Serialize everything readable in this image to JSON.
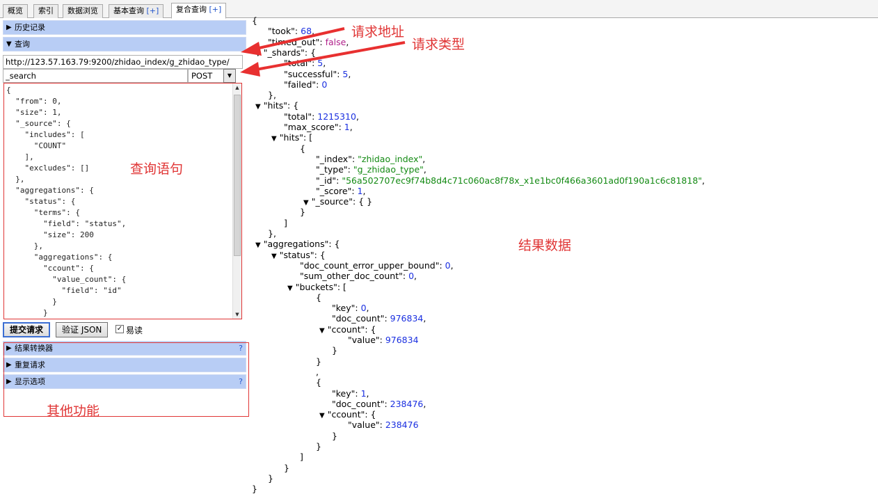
{
  "tabs": [
    {
      "label": "概览",
      "plus": ""
    },
    {
      "label": "索引",
      "plus": ""
    },
    {
      "label": "数据浏览",
      "plus": ""
    },
    {
      "label": "基本查询",
      "plus": "[+]"
    },
    {
      "label": "复合查询",
      "plus": "[+]"
    }
  ],
  "left": {
    "history_label": "历史记录",
    "query_label": "查询",
    "url_value": "http://123.57.163.79:9200/zhidao_index/g_zhidao_type/",
    "path_value": "_search",
    "method_value": "POST",
    "editor_text": "{\n  \"from\": 0,\n  \"size\": 1,\n  \"_source\": {\n    \"includes\": [\n      \"COUNT\"\n    ],\n    \"excludes\": []\n  },\n  \"aggregations\": {\n    \"status\": {\n      \"terms\": {\n        \"field\": \"status\",\n        \"size\": 200\n      },\n      \"aggregations\": {\n        \"ccount\": {\n          \"value_count\": {\n            \"field\": \"id\"\n          }\n        }",
    "submit_label": "提交请求",
    "validate_label": "验证 JSON",
    "easy_label": "易读",
    "easy_checked": "✓",
    "sections": [
      {
        "label": "结果转换器",
        "help": "?"
      },
      {
        "label": "重复请求",
        "help": ""
      },
      {
        "label": "显示选项",
        "help": "?"
      }
    ]
  },
  "annotations": {
    "request_address": "请求地址",
    "request_type": "请求类型",
    "query_statement": "查询语句",
    "result_data": "结果数据",
    "other_functions": "其他功能"
  },
  "result_lines": [
    {
      "i": 0,
      "t": false,
      "parts": [
        {
          "c": "k",
          "v": "{"
        }
      ]
    },
    {
      "i": 1,
      "t": false,
      "parts": [
        {
          "c": "k",
          "v": "\"took\": "
        },
        {
          "c": "num",
          "v": "68"
        },
        {
          "c": "k",
          "v": ","
        }
      ]
    },
    {
      "i": 1,
      "t": false,
      "parts": [
        {
          "c": "k",
          "v": "\"timed_out\": "
        },
        {
          "c": "bool",
          "v": "false"
        },
        {
          "c": "k",
          "v": ","
        }
      ]
    },
    {
      "i": 1,
      "t": true,
      "parts": [
        {
          "c": "k",
          "v": "\"_shards\": {"
        }
      ]
    },
    {
      "i": 2,
      "t": false,
      "parts": [
        {
          "c": "k",
          "v": "\"total\": "
        },
        {
          "c": "num",
          "v": "5"
        },
        {
          "c": "k",
          "v": ","
        }
      ]
    },
    {
      "i": 2,
      "t": false,
      "parts": [
        {
          "c": "k",
          "v": "\"successful\": "
        },
        {
          "c": "num",
          "v": "5"
        },
        {
          "c": "k",
          "v": ","
        }
      ]
    },
    {
      "i": 2,
      "t": false,
      "parts": [
        {
          "c": "k",
          "v": "\"failed\": "
        },
        {
          "c": "num",
          "v": "0"
        }
      ]
    },
    {
      "i": 1,
      "t": false,
      "parts": [
        {
          "c": "k",
          "v": "},"
        }
      ]
    },
    {
      "i": 1,
      "t": true,
      "parts": [
        {
          "c": "k",
          "v": "\"hits\": {"
        }
      ]
    },
    {
      "i": 2,
      "t": false,
      "parts": [
        {
          "c": "k",
          "v": "\"total\": "
        },
        {
          "c": "num",
          "v": "1215310"
        },
        {
          "c": "k",
          "v": ","
        }
      ]
    },
    {
      "i": 2,
      "t": false,
      "parts": [
        {
          "c": "k",
          "v": "\"max_score\": "
        },
        {
          "c": "num",
          "v": "1"
        },
        {
          "c": "k",
          "v": ","
        }
      ]
    },
    {
      "i": 2,
      "t": true,
      "parts": [
        {
          "c": "k",
          "v": "\"hits\": ["
        }
      ]
    },
    {
      "i": 3,
      "t": false,
      "parts": [
        {
          "c": "k",
          "v": "{"
        }
      ]
    },
    {
      "i": 4,
      "t": false,
      "parts": [
        {
          "c": "k",
          "v": "\"_index\": "
        },
        {
          "c": "str",
          "v": "\"zhidao_index\""
        },
        {
          "c": "k",
          "v": ","
        }
      ]
    },
    {
      "i": 4,
      "t": false,
      "parts": [
        {
          "c": "k",
          "v": "\"_type\": "
        },
        {
          "c": "str",
          "v": "\"g_zhidao_type\""
        },
        {
          "c": "k",
          "v": ","
        }
      ]
    },
    {
      "i": 4,
      "t": false,
      "parts": [
        {
          "c": "k",
          "v": "\"_id\": "
        },
        {
          "c": "str",
          "v": "\"56a502707ec9f74b8d4c71c060ac8f78x_x1e1bc0f466a3601ad0f190a1c6c81818\""
        },
        {
          "c": "k",
          "v": ","
        }
      ]
    },
    {
      "i": 4,
      "t": false,
      "parts": [
        {
          "c": "k",
          "v": "\"_score\": "
        },
        {
          "c": "num",
          "v": "1"
        },
        {
          "c": "k",
          "v": ","
        }
      ]
    },
    {
      "i": 4,
      "t": true,
      "parts": [
        {
          "c": "k",
          "v": "\"_source\": { }"
        }
      ]
    },
    {
      "i": 3,
      "t": false,
      "parts": [
        {
          "c": "k",
          "v": "}"
        }
      ]
    },
    {
      "i": 2,
      "t": false,
      "parts": [
        {
          "c": "k",
          "v": "]"
        }
      ]
    },
    {
      "i": 1,
      "t": false,
      "parts": [
        {
          "c": "k",
          "v": "},"
        }
      ]
    },
    {
      "i": 1,
      "t": true,
      "parts": [
        {
          "c": "k",
          "v": "\"aggregations\": {"
        }
      ]
    },
    {
      "i": 2,
      "t": true,
      "parts": [
        {
          "c": "k",
          "v": "\"status\": {"
        }
      ]
    },
    {
      "i": 3,
      "t": false,
      "parts": [
        {
          "c": "k",
          "v": "\"doc_count_error_upper_bound\": "
        },
        {
          "c": "num",
          "v": "0"
        },
        {
          "c": "k",
          "v": ","
        }
      ]
    },
    {
      "i": 3,
      "t": false,
      "parts": [
        {
          "c": "k",
          "v": "\"sum_other_doc_count\": "
        },
        {
          "c": "num",
          "v": "0"
        },
        {
          "c": "k",
          "v": ","
        }
      ]
    },
    {
      "i": 3,
      "t": true,
      "parts": [
        {
          "c": "k",
          "v": "\"buckets\": ["
        }
      ]
    },
    {
      "i": 4,
      "t": false,
      "parts": [
        {
          "c": "k",
          "v": "{"
        }
      ]
    },
    {
      "i": 5,
      "t": false,
      "parts": [
        {
          "c": "k",
          "v": "\"key\": "
        },
        {
          "c": "num",
          "v": "0"
        },
        {
          "c": "k",
          "v": ","
        }
      ]
    },
    {
      "i": 5,
      "t": false,
      "parts": [
        {
          "c": "k",
          "v": "\"doc_count\": "
        },
        {
          "c": "num",
          "v": "976834"
        },
        {
          "c": "k",
          "v": ","
        }
      ]
    },
    {
      "i": 5,
      "t": true,
      "parts": [
        {
          "c": "k",
          "v": "\"ccount\": {"
        }
      ]
    },
    {
      "i": 6,
      "t": false,
      "parts": [
        {
          "c": "k",
          "v": "\"value\": "
        },
        {
          "c": "num",
          "v": "976834"
        }
      ]
    },
    {
      "i": 5,
      "t": false,
      "parts": [
        {
          "c": "k",
          "v": "}"
        }
      ]
    },
    {
      "i": 4,
      "t": false,
      "parts": [
        {
          "c": "k",
          "v": "}"
        }
      ]
    },
    {
      "i": 4,
      "t": false,
      "parts": [
        {
          "c": "k",
          "v": ","
        }
      ]
    },
    {
      "i": 4,
      "t": false,
      "parts": [
        {
          "c": "k",
          "v": "{"
        }
      ]
    },
    {
      "i": 5,
      "t": false,
      "parts": [
        {
          "c": "k",
          "v": "\"key\": "
        },
        {
          "c": "num",
          "v": "1"
        },
        {
          "c": "k",
          "v": ","
        }
      ]
    },
    {
      "i": 5,
      "t": false,
      "parts": [
        {
          "c": "k",
          "v": "\"doc_count\": "
        },
        {
          "c": "num",
          "v": "238476"
        },
        {
          "c": "k",
          "v": ","
        }
      ]
    },
    {
      "i": 5,
      "t": true,
      "parts": [
        {
          "c": "k",
          "v": "\"ccount\": {"
        }
      ]
    },
    {
      "i": 6,
      "t": false,
      "parts": [
        {
          "c": "k",
          "v": "\"value\": "
        },
        {
          "c": "num",
          "v": "238476"
        }
      ]
    },
    {
      "i": 5,
      "t": false,
      "parts": [
        {
          "c": "k",
          "v": "}"
        }
      ]
    },
    {
      "i": 4,
      "t": false,
      "parts": [
        {
          "c": "k",
          "v": "}"
        }
      ]
    },
    {
      "i": 3,
      "t": false,
      "parts": [
        {
          "c": "k",
          "v": "]"
        }
      ]
    },
    {
      "i": 2,
      "t": false,
      "parts": [
        {
          "c": "k",
          "v": "}"
        }
      ]
    },
    {
      "i": 1,
      "t": false,
      "parts": [
        {
          "c": "k",
          "v": "}"
        }
      ]
    },
    {
      "i": 0,
      "t": false,
      "parts": [
        {
          "c": "k",
          "v": "}"
        }
      ]
    }
  ]
}
